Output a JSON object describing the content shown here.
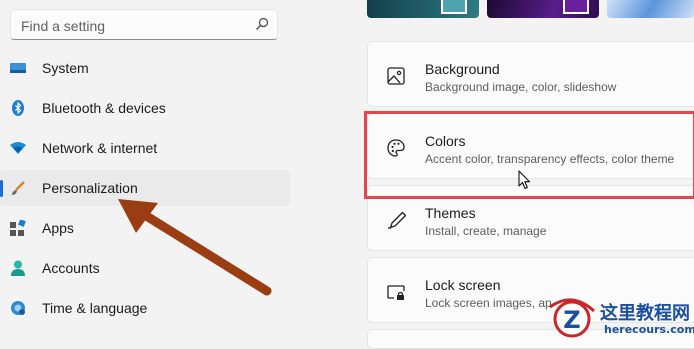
{
  "search": {
    "placeholder": "Find a setting",
    "icon": "search-icon"
  },
  "nav": {
    "items": [
      {
        "label": "System",
        "icon": "system-icon"
      },
      {
        "label": "Bluetooth & devices",
        "icon": "bluetooth-icon"
      },
      {
        "label": "Network & internet",
        "icon": "wifi-icon"
      },
      {
        "label": "Personalization",
        "icon": "brush-icon",
        "selected": true
      },
      {
        "label": "Apps",
        "icon": "apps-icon"
      },
      {
        "label": "Accounts",
        "icon": "person-icon"
      },
      {
        "label": "Time & language",
        "icon": "globe-icon"
      }
    ]
  },
  "cards": [
    {
      "title": "Background",
      "subtitle": "Background image, color, slideshow",
      "icon": "image-icon"
    },
    {
      "title": "Colors",
      "subtitle": "Accent color, transparency effects, color theme",
      "icon": "palette-icon"
    },
    {
      "title": "Themes",
      "subtitle": "Install, create, manage",
      "icon": "pen-icon"
    },
    {
      "title": "Lock screen",
      "subtitle": "Lock screen images, ap",
      "icon": "lock-screen-icon"
    }
  ],
  "watermark": {
    "title": "这里教程网",
    "url": "herecours.com"
  },
  "colors": {
    "accent": "#1a6ed0",
    "highlight": "#e2474c",
    "arrow": "#9a3d12"
  }
}
